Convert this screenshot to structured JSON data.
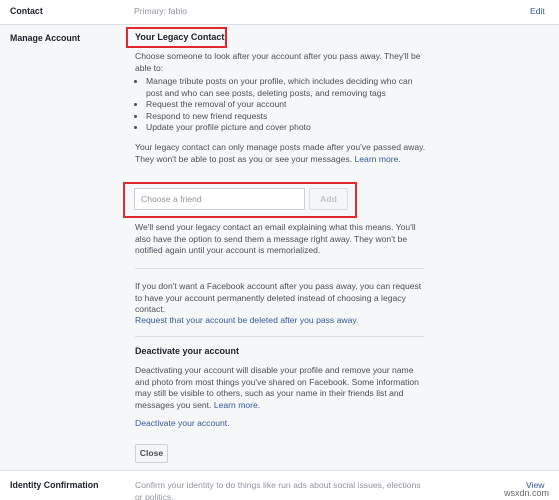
{
  "contact": {
    "label": "Contact",
    "value": "Primary: fabio",
    "edit": "Edit"
  },
  "manage": {
    "label": "Manage Account",
    "legacy_title": "Your Legacy Contact",
    "intro": "Choose someone to look after your account after you pass away. They'll be able to:",
    "bullets": [
      "Manage tribute posts on your profile, which includes deciding who can post and who can see posts, deleting posts, and removing tags",
      "Request the removal of your account",
      "Respond to new friend requests",
      "Update your profile picture and cover photo"
    ],
    "limit_text": "Your legacy contact can only manage posts made after you've passed away. They won't be able to post as you or see your messages.",
    "learn_more": "Learn more.",
    "friend_placeholder": "Choose a friend",
    "add_label": "Add",
    "notify_text": "We'll send your legacy contact an email explaining what this means. You'll also have the option to send them a message right away. They won't be notified again until your account is memorialized.",
    "delete_text": "If you don't want a Facebook account after you pass away, you can request to have your account permanently deleted instead of choosing a legacy contact.",
    "delete_link": "Request that your account be deleted after you pass away.",
    "deactivate_title": "Deactivate your account",
    "deactivate_text": "Deactivating your account will disable your profile and remove your name and photo from most things you've shared on Facebook. Some information may still be visible to others, such as your name in their friends list and messages you sent.",
    "deactivate_learn": "Learn more.",
    "deactivate_link": "Deactivate your account.",
    "close_label": "Close"
  },
  "identity": {
    "label": "Identity Confirmation",
    "text": "Confirm your identity to do things like run ads about social issues, elections or politics.",
    "view": "View"
  },
  "watermark": "wsxdn.com",
  "colors": {
    "highlight": "#e0292f",
    "link": "#365899",
    "panel_bg": "#f6f7f9"
  }
}
